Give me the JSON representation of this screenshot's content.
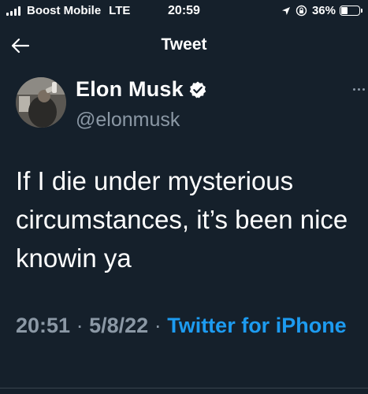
{
  "status_bar": {
    "carrier": "Boost Mobile",
    "network": "LTE",
    "time": "20:59",
    "battery_percent": "36%",
    "battery_level": 0.36
  },
  "header": {
    "title": "Tweet"
  },
  "tweet": {
    "author_name": "Elon Musk",
    "handle": "@elonmusk",
    "text": "If I die under mysterious circumstances, it’s been nice knowin ya",
    "time": "20:51",
    "date": "5/8/22",
    "separator": "·",
    "source": "Twitter for iPhone"
  },
  "colors": {
    "background": "#15202b",
    "text": "#ffffff",
    "secondary": "#8b98a5",
    "accent": "#1d9bf0"
  },
  "icons": {
    "back": "arrow-left-icon",
    "verified": "verified-badge-icon",
    "more": "more-options-icon",
    "location": "location-arrow-icon",
    "rotation_lock": "rotation-lock-icon"
  }
}
